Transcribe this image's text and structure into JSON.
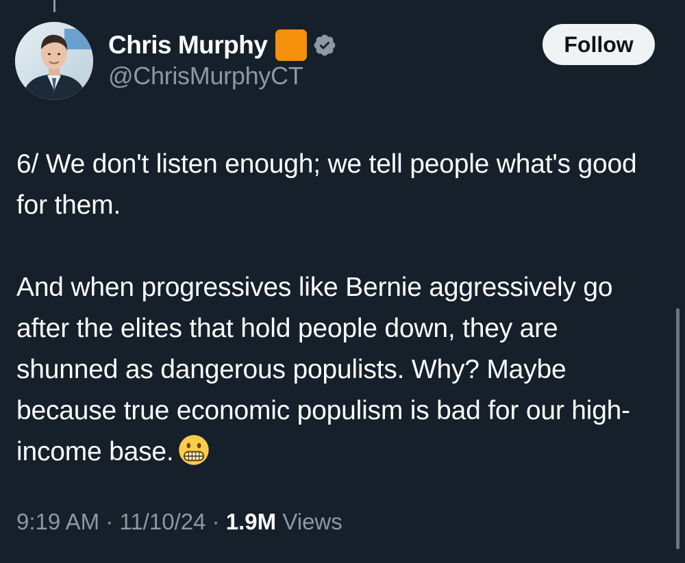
{
  "author": {
    "display_name": "Chris Murphy",
    "handle": "@ChrisMurphyCT",
    "badge_icon": "orange-square-icon",
    "verified_icon": "verified-badge-icon"
  },
  "follow_button": {
    "label": "Follow"
  },
  "tweet": {
    "paragraph_1": "6/ We don't listen enough; we tell people what's good for them.",
    "paragraph_2": "And when progressives like Bernie aggressively go after the elites that hold people down, they are shunned as dangerous populists. Why? Maybe because true economic populism is bad for our high-income base.",
    "emoji_icon": "grimacing-face-emoji"
  },
  "meta": {
    "time": "9:19 AM",
    "date": "11/10/24",
    "separator": "·",
    "views_count": "1.9M",
    "views_label": "Views"
  },
  "colors": {
    "background": "#15202b",
    "text_primary": "#ffffff",
    "text_secondary": "#8b98a5",
    "follow_bg": "#eff3f4",
    "badge_orange": "#f4900c"
  }
}
